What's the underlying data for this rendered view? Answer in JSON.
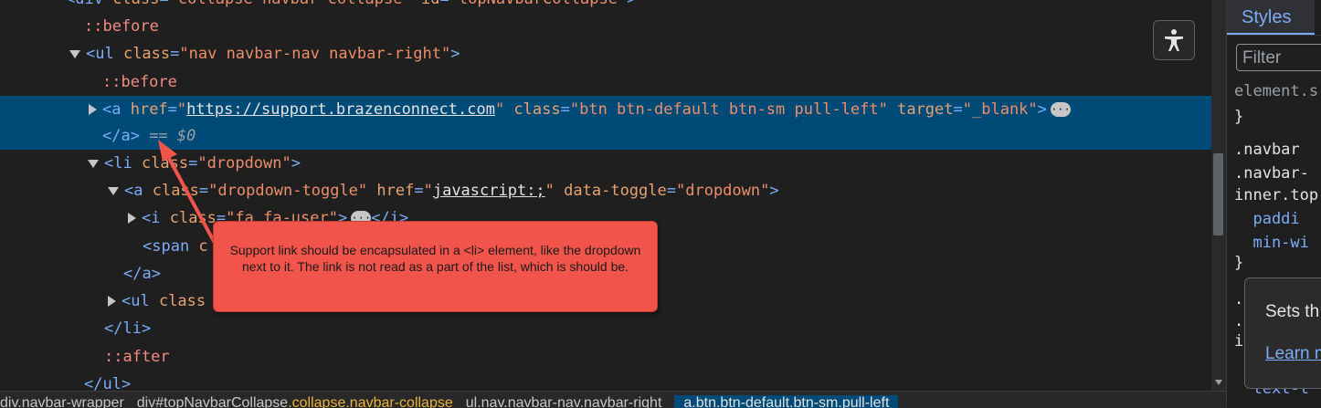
{
  "dom_lines": [
    {
      "id": "l0",
      "pre": "    ",
      "parts": [
        {
          "c": "tag",
          "t": "<div "
        },
        {
          "c": "an",
          "t": "class"
        },
        {
          "c": "tag",
          "t": "="
        },
        {
          "c": "av",
          "t": "\"collapse navbar-collapse\""
        },
        {
          "c": "an",
          "t": " id"
        },
        {
          "c": "tag",
          "t": "="
        },
        {
          "c": "av",
          "t": "\"topNavbarCollapse\""
        },
        {
          "c": "tag",
          "t": ">"
        }
      ]
    },
    {
      "id": "l1",
      "pre": "     ",
      "parts": [
        {
          "c": "pseudo",
          "t": "::before"
        }
      ]
    },
    {
      "id": "l2",
      "pre": "",
      "parts": [
        {
          "c": "tag",
          "t": "<ul "
        },
        {
          "c": "an",
          "t": "class"
        },
        {
          "c": "tag",
          "t": "="
        },
        {
          "c": "av",
          "t": "\"nav navbar-nav navbar-right\""
        },
        {
          "c": "tag",
          "t": ">"
        }
      ]
    },
    {
      "id": "l3",
      "pre": "      ",
      "parts": [
        {
          "c": "pseudo",
          "t": "::before"
        }
      ]
    },
    {
      "id": "l4",
      "pre": "",
      "parts": [
        {
          "c": "tag",
          "t": "<a "
        },
        {
          "c": "an",
          "t": "href"
        },
        {
          "c": "tag",
          "t": "="
        },
        {
          "c": "av",
          "t": "\""
        },
        {
          "c": "link",
          "t": "https://support.brazenconnect.com"
        },
        {
          "c": "av",
          "t": "\""
        },
        {
          "c": "an",
          "t": " class"
        },
        {
          "c": "tag",
          "t": "="
        },
        {
          "c": "av",
          "t": "\"btn btn-default btn-sm pull-left\""
        },
        {
          "c": "an",
          "t": " target"
        },
        {
          "c": "tag",
          "t": "="
        },
        {
          "c": "av",
          "t": "\"_blank\""
        },
        {
          "c": "tag",
          "t": ">"
        }
      ]
    },
    {
      "id": "l5",
      "pre": "      ",
      "parts": [
        {
          "c": "tag",
          "t": "</a>"
        },
        {
          "c": "eq",
          "t": " == $0"
        }
      ]
    },
    {
      "id": "l6",
      "pre": "",
      "parts": [
        {
          "c": "tag",
          "t": "<li "
        },
        {
          "c": "an",
          "t": "class"
        },
        {
          "c": "tag",
          "t": "="
        },
        {
          "c": "av",
          "t": "\"dropdown\""
        },
        {
          "c": "tag",
          "t": ">"
        }
      ]
    },
    {
      "id": "l7",
      "pre": "",
      "parts": [
        {
          "c": "tag",
          "t": "<a "
        },
        {
          "c": "an",
          "t": "class"
        },
        {
          "c": "tag",
          "t": "="
        },
        {
          "c": "av",
          "t": "\"dropdown-toggle\""
        },
        {
          "c": "an",
          "t": " href"
        },
        {
          "c": "tag",
          "t": "="
        },
        {
          "c": "av",
          "t": "\""
        },
        {
          "c": "link",
          "t": "javascript:;"
        },
        {
          "c": "av",
          "t": "\""
        },
        {
          "c": "an",
          "t": " data-toggle"
        },
        {
          "c": "tag",
          "t": "="
        },
        {
          "c": "av",
          "t": "\"dropdown\""
        },
        {
          "c": "tag",
          "t": ">"
        }
      ]
    },
    {
      "id": "l8",
      "pre": "",
      "parts": [
        {
          "c": "tag",
          "t": "<i "
        },
        {
          "c": "an",
          "t": "class"
        },
        {
          "c": "tag",
          "t": "="
        },
        {
          "c": "av",
          "t": "\"fa fa-user\""
        },
        {
          "c": "tag",
          "t": ">"
        },
        {
          "c": "dots",
          "t": "···"
        },
        {
          "c": "tag",
          "t": "</i>"
        }
      ]
    },
    {
      "id": "l9",
      "pre": "          ",
      "parts": [
        {
          "c": "tag",
          "t": "<span "
        },
        {
          "c": "an",
          "t": "c"
        }
      ]
    },
    {
      "id": "l10",
      "pre": "        ",
      "parts": [
        {
          "c": "tag",
          "t": "</a>"
        }
      ]
    },
    {
      "id": "l11",
      "pre": "",
      "parts": [
        {
          "c": "tag",
          "t": "<ul "
        },
        {
          "c": "an",
          "t": "class"
        }
      ]
    },
    {
      "id": "l12",
      "pre": "      ",
      "parts": [
        {
          "c": "tag",
          "t": "</li>"
        }
      ]
    },
    {
      "id": "l13",
      "pre": "      ",
      "parts": [
        {
          "c": "pseudo",
          "t": "::after"
        }
      ]
    },
    {
      "id": "l14",
      "pre": "    ",
      "parts": [
        {
          "c": "tag",
          "t": "</ul>"
        }
      ]
    }
  ],
  "styles": {
    "tab_label": "Styles",
    "filter_placeholder": "Filter",
    "lines": [
      {
        "c": "dim",
        "t": "element.s"
      },
      {
        "c": "",
        "t": "}"
      },
      {
        "c": "",
        "t": ".navbar "
      },
      {
        "c": "",
        "t": ".navbar-"
      },
      {
        "c": "",
        "t": "inner.top"
      },
      {
        "c": "prop",
        "t": "  paddi"
      },
      {
        "c": "prop",
        "t": "  min-wi"
      },
      {
        "c": "",
        "t": "}"
      },
      {
        "c": "",
        "t": "."
      },
      {
        "c": "",
        "t": "."
      },
      {
        "c": "",
        "t": "i"
      },
      {
        "c": "prop",
        "t": "  text-t"
      }
    ]
  },
  "tooltip": {
    "text": "Sets th",
    "link": "Learn m"
  },
  "breadcrumbs": [
    {
      "t": "div.navbar-wrapper",
      "cls": ""
    },
    {
      "t": "div#topNavbarCollapse",
      "cls": ".collapse.navbar-collapse"
    },
    {
      "t": "ul.nav.navbar-nav.navbar-right",
      "cls": ""
    },
    {
      "t": "a.btn.btn-default.btn-sm.pull-left",
      "cls": "",
      "active": true
    }
  ],
  "callout": {
    "text": "Support link should be encapsulated in a <li> element, like the dropdown next to it. The link is not read as a part of the list, which is should be.",
    "color": "#f1544a"
  },
  "accessibility_button_icon": "accessibility-person-icon"
}
